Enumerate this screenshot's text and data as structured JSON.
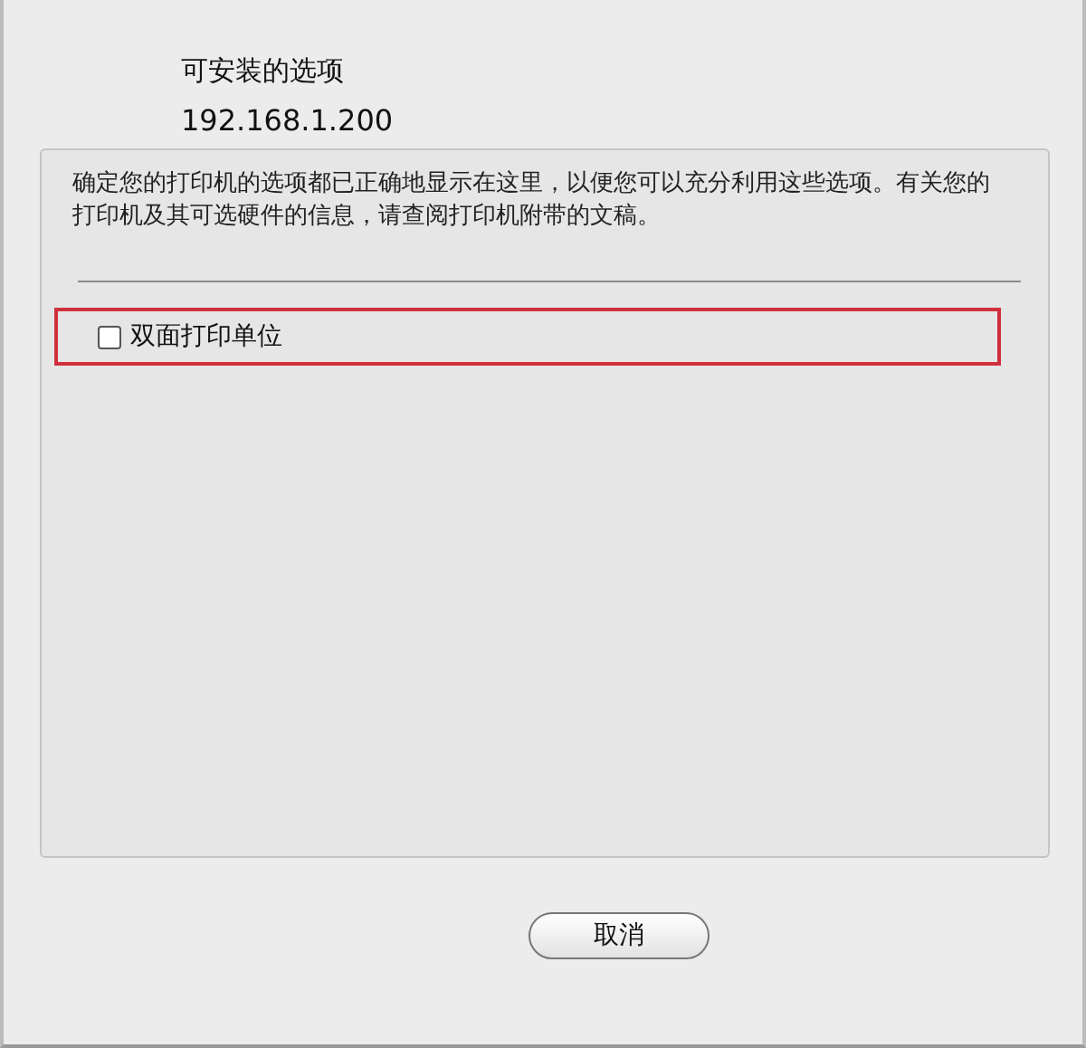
{
  "sheet": {
    "title": "可安装的选项",
    "address": "192.168.1.200"
  },
  "panel": {
    "description": "确定您的打印机的选项都已正确地显示在这里，以便您可以充分利用这些选项。有关您的打印机及其可选硬件的信息，请查阅打印机附带的文稿。",
    "options": [
      {
        "label": "双面打印单位",
        "checked": false,
        "highlighted": true
      }
    ]
  },
  "buttons": [
    {
      "label": "取消"
    }
  ]
}
